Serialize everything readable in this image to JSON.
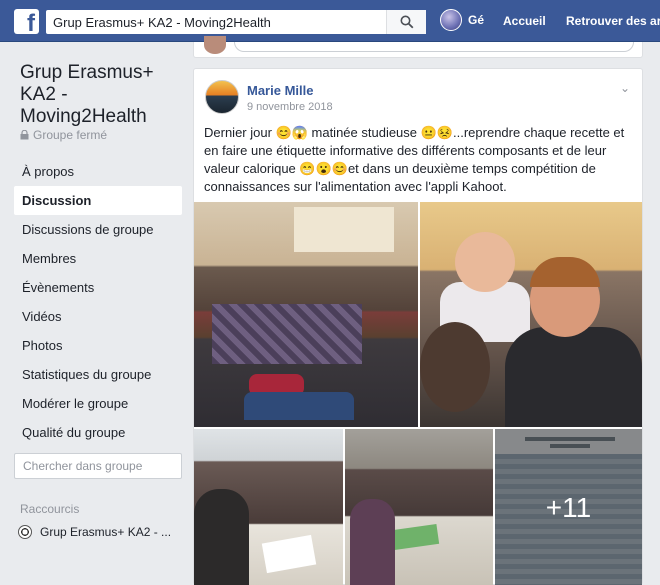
{
  "topbar": {
    "search_value": "Grup Erasmus+ KA2 - Moving2Health",
    "profile_name": "Gé",
    "nav_home": "Accueil",
    "nav_find_friends": "Retrouver des ar"
  },
  "sidebar": {
    "group_title": "Grup Erasmus+ KA2 - Moving2Health",
    "group_status": "Groupe fermé",
    "items": [
      {
        "label": "À propos",
        "active": false
      },
      {
        "label": "Discussion",
        "active": true
      },
      {
        "label": "Discussions de groupe",
        "active": false
      },
      {
        "label": "Membres",
        "active": false
      },
      {
        "label": "Évènements",
        "active": false
      },
      {
        "label": "Vidéos",
        "active": false
      },
      {
        "label": "Photos",
        "active": false
      },
      {
        "label": "Statistiques du groupe",
        "active": false
      },
      {
        "label": "Modérer le groupe",
        "active": false
      },
      {
        "label": "Qualité du groupe",
        "active": false
      }
    ],
    "search_placeholder": "Chercher dans groupe",
    "shortcuts_title": "Raccourcis",
    "shortcut_label": "Grup Erasmus+ KA2 - ..."
  },
  "post": {
    "author": "Marie Mille",
    "date": "9 novembre 2018",
    "text": "Dernier jour 😊😱 matinée studieuse 😐😣...reprendre chaque recette et en faire une étiquette informative des différents composants et de leur valeur calorique 😁😮😊et dans un deuxième temps compétition de connaissances sur l'alimentation avec l'appli Kahoot.",
    "more_photos": "+11"
  },
  "colors": {
    "brand": "#3b5998",
    "link": "#365899",
    "background": "#e9ebee"
  }
}
